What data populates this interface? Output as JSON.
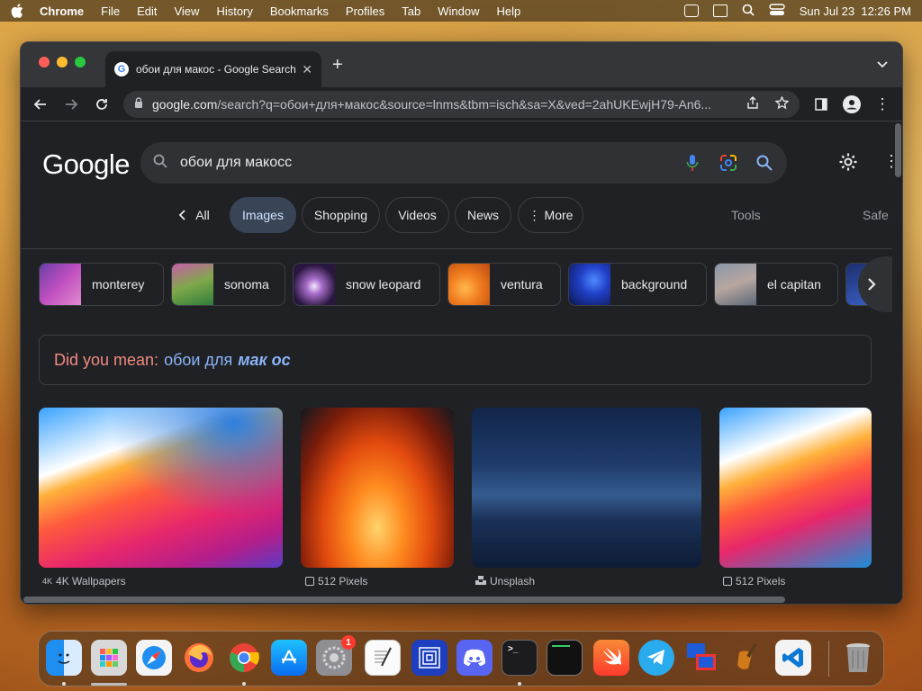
{
  "menubar": {
    "app": "Chrome",
    "items": [
      "File",
      "Edit",
      "View",
      "History",
      "Bookmarks",
      "Profiles",
      "Tab",
      "Window",
      "Help"
    ],
    "datetime": "Sun Jul 23  12:26 PM"
  },
  "browser": {
    "tab_title": "обои для макос - Google Search",
    "url_domain": "google.com",
    "url_path": "/search?q=обои+для+макос&source=lnms&tbm=isch&sa=X&ved=2ahUKEwjH79-An6..."
  },
  "google": {
    "logo": "Google",
    "query": "обои для макосс",
    "filters": {
      "back_all": "All",
      "chips": [
        "Images",
        "Shopping",
        "Videos",
        "News",
        "More"
      ],
      "active": "Images",
      "tools": "Tools",
      "safe": "Safe"
    },
    "suggestions": [
      "monterey",
      "sonoma",
      "snow leopard",
      "ventura",
      "background",
      "el capitan"
    ],
    "did_you_mean": {
      "label": "Did you mean:",
      "plain": "обои для",
      "corrected": "мак ос"
    },
    "results": [
      {
        "source": "4K Wallpapers"
      },
      {
        "source": "512 Pixels"
      },
      {
        "source": "Unsplash"
      },
      {
        "source": "512 Pixels"
      }
    ]
  },
  "dock": {
    "badge_count": "1",
    "apps": [
      "finder-icon",
      "launchpad-icon",
      "safari-icon",
      "firefox-icon",
      "chrome-icon",
      "app-store-icon",
      "system-settings-icon",
      "textedit-icon",
      "screens-icon",
      "discord-icon",
      "terminal-icon",
      "console-icon",
      "swift-icon",
      "telegram-icon",
      "remote-desktop-icon",
      "instruments-icon",
      "vscode-icon",
      "trash-icon"
    ]
  },
  "colors": {
    "accent": "#8ab4f8",
    "chip_active": "#394457",
    "bg": "#202124",
    "suggest": "#f28b82"
  }
}
